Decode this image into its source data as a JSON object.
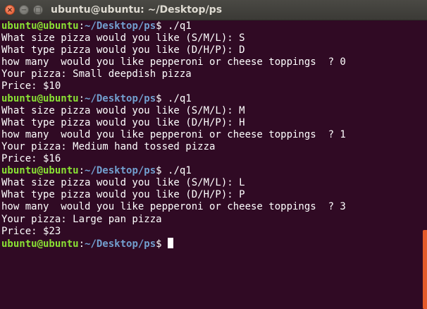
{
  "window": {
    "title": "ubuntu@ubuntu: ~/Desktop/ps",
    "close_glyph": "×",
    "minimize_glyph": "−",
    "maximize_glyph": "□"
  },
  "prompt": {
    "user_host": "ubuntu@ubuntu",
    "sep": ":",
    "path": "~/Desktop/ps",
    "symbol": "$ "
  },
  "lines": [
    {
      "prompt": true,
      "cmd": "./q1"
    },
    {
      "text": "What size pizza would you like (S/M/L): S"
    },
    {
      "text": "What type pizza would you like (D/H/P): D"
    },
    {
      "text": "how many  would you like pepperoni or cheese toppings  ? 0"
    },
    {
      "text": "Your pizza: Small deepdish pizza"
    },
    {
      "text": "Price: $10"
    },
    {
      "prompt": true,
      "cmd": "./q1"
    },
    {
      "text": "What size pizza would you like (S/M/L): M"
    },
    {
      "text": "What type pizza would you like (D/H/P): H"
    },
    {
      "text": "how many  would you like pepperoni or cheese toppings  ? 1"
    },
    {
      "text": "Your pizza: Medium hand tossed pizza"
    },
    {
      "text": "Price: $16"
    },
    {
      "prompt": true,
      "cmd": "./q1"
    },
    {
      "text": "What size pizza would you like (S/M/L): L"
    },
    {
      "text": "What type pizza would you like (D/H/P): P"
    },
    {
      "text": "how many  would you like pepperoni or cheese toppings  ? 3"
    },
    {
      "text": "Your pizza: Large pan pizza"
    },
    {
      "text": "Price: $23"
    },
    {
      "prompt": true,
      "cmd": "",
      "cursor": true
    }
  ],
  "colors": {
    "background": "#300a24",
    "prompt_user": "#8ae234",
    "prompt_path": "#729fcf",
    "text": "#ffffff",
    "scroll_accent": "#e35a2a"
  }
}
